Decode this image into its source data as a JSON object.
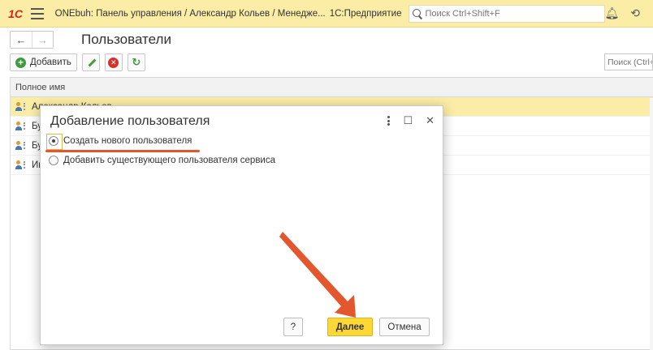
{
  "topbar": {
    "logo": "1С",
    "title": "ONEbuh: Панель управления / Александр Кольев / Менедже...",
    "platform": "1С:Предприятие",
    "search_placeholder": "Поиск Ctrl+Shift+F"
  },
  "nav": {
    "back_label": "←",
    "forward_label": "→",
    "page_title": "Пользователи"
  },
  "toolbar": {
    "add_label": "Добавить",
    "list_search_placeholder": "Поиск (Ctrl+"
  },
  "table": {
    "column_header": "Полное имя",
    "rows": [
      {
        "name": "Александр Кольев"
      },
      {
        "name": "Бу"
      },
      {
        "name": "Бу"
      },
      {
        "name": "Ив"
      }
    ]
  },
  "modal": {
    "title": "Добавление пользователя",
    "options": [
      {
        "label": "Создать нового пользователя",
        "checked": true
      },
      {
        "label": "Добавить существующего пользователя сервиса",
        "checked": false
      }
    ],
    "help_label": "?",
    "next_label": "Далее",
    "cancel_label": "Отмена"
  },
  "colors": {
    "accent_yellow": "#fbeda6",
    "primary_button": "#fdd835",
    "annotation_red": "#e4562d"
  }
}
